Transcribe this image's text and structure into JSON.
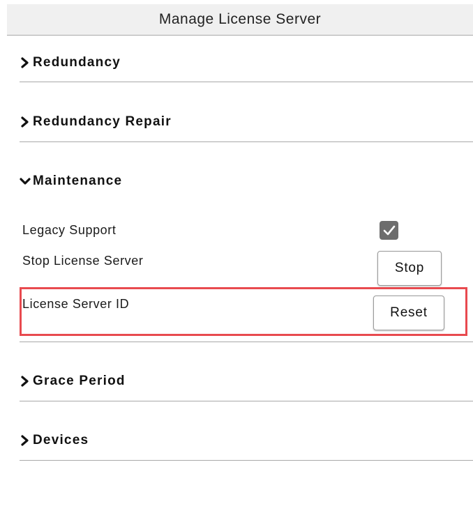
{
  "header": {
    "title": "Manage License Server"
  },
  "sections": {
    "redundancy": {
      "label": "Redundancy",
      "expanded": false
    },
    "redundancy_repair": {
      "label": "Redundancy Repair",
      "expanded": false
    },
    "maintenance": {
      "label": "Maintenance",
      "expanded": true
    },
    "grace_period": {
      "label": "Grace Period",
      "expanded": false
    },
    "devices": {
      "label": "Devices",
      "expanded": false
    }
  },
  "maintenance": {
    "legacy_support": {
      "label": "Legacy Support",
      "checked": true
    },
    "stop_license_server": {
      "label": "Stop License Server",
      "button_label": "Stop"
    },
    "license_server_id": {
      "label": "License Server ID",
      "button_label": "Reset"
    }
  },
  "icons": {
    "collapsed": "chevron-right-icon",
    "expanded": "chevron-down-icon",
    "checkbox": "check-icon"
  },
  "colors": {
    "highlight": "#e84a4f",
    "checkbox_fill": "#6d6d6d",
    "header_bg": "#f0f0f0"
  }
}
